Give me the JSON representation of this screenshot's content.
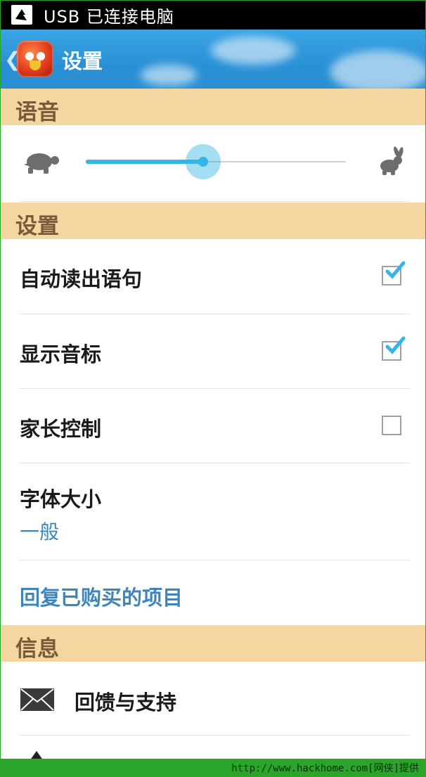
{
  "status_bar": {
    "text": "USB 已连接电脑"
  },
  "action_bar": {
    "back_glyph": "❮",
    "title": "设置"
  },
  "sections": {
    "voice": "语音",
    "settings": "设置",
    "info": "信息"
  },
  "speech_speed": {
    "value_fraction": 0.45
  },
  "preferences": {
    "auto_read": {
      "label": "自动读出语句",
      "checked": true
    },
    "show_phonetic": {
      "label": "显示音标",
      "checked": true
    },
    "parental_control": {
      "label": "家长控制",
      "checked": false
    },
    "font_size": {
      "label": "字体大小",
      "value": "一般"
    },
    "restore_purchases": {
      "label": "回复已购买的项目"
    }
  },
  "info_items": [
    {
      "label": "回馈与支持",
      "icon": "mail-icon"
    }
  ],
  "watermark": {
    "text": "http://www.hackhome.com[网侠]提供"
  },
  "colors": {
    "accent": "#33b5e5",
    "section_header_bg": "#f5d6a0",
    "section_header_text": "#7a5a3a",
    "link_text": "#3d86bd",
    "actionbar_bg": "#2a90d6"
  }
}
